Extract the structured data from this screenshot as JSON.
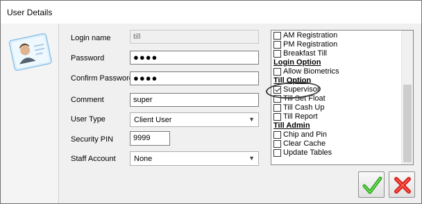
{
  "window": {
    "title": "User Details"
  },
  "form": {
    "login_name": {
      "label": "Login name",
      "value": "till"
    },
    "password": {
      "label": "Password",
      "value": "●●●●"
    },
    "confirm_password": {
      "label": "Confirm Password",
      "value": "●●●●"
    },
    "comment": {
      "label": "Comment",
      "value": "super"
    },
    "user_type": {
      "label": "User Type",
      "value": "Client User"
    },
    "security_pin": {
      "label": "Security PIN",
      "value": "9999"
    },
    "staff_account": {
      "label": "Staff Account",
      "value": "None"
    }
  },
  "permissions": {
    "items_top": [
      {
        "label": "AM Registration",
        "checked": false
      },
      {
        "label": "PM Registration",
        "checked": false
      },
      {
        "label": "Breakfast Till",
        "checked": false
      }
    ],
    "login_option": {
      "header": "Login Option",
      "items": [
        {
          "label": "Allow Biometrics",
          "checked": false
        }
      ]
    },
    "till_option": {
      "header": "Till Option",
      "items": [
        {
          "label": "Supervisor",
          "checked": true
        },
        {
          "label": "Till Set Float",
          "checked": false
        },
        {
          "label": "Till Cash Up",
          "checked": false
        },
        {
          "label": "Till Report",
          "checked": false
        }
      ]
    },
    "till_admin": {
      "header": "Till Admin",
      "items": [
        {
          "label": "Chip and Pin",
          "checked": false
        },
        {
          "label": "Clear Cache",
          "checked": false
        },
        {
          "label": "Update Tables",
          "checked": false
        }
      ]
    }
  },
  "icons": {
    "user_card": "user-card-icon",
    "ok": "green-check-icon",
    "cancel": "red-x-icon"
  },
  "colors": {
    "ok_green": "#2faa1f",
    "cancel_red": "#d8231b"
  }
}
